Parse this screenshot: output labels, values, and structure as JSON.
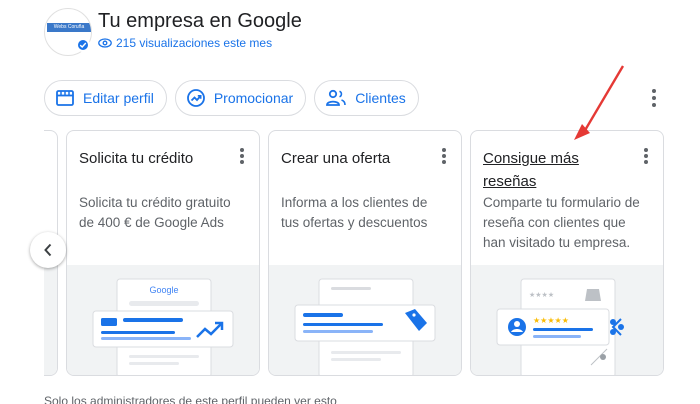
{
  "header": {
    "title": "Tu empresa en Google",
    "views_text": "215 visualizaciones este mes",
    "logo_text": "Webs Coruña"
  },
  "chips": [
    {
      "label": "Editar perfil",
      "icon": "storefront-icon"
    },
    {
      "label": "Promocionar",
      "icon": "trending-up-icon"
    },
    {
      "label": "Clientes",
      "icon": "people-icon"
    }
  ],
  "cards": [
    {
      "title": "Solicita tu crédito",
      "desc_lines": [
        "Solicita tu crédito gratuito",
        "de 400 € de Google Ads"
      ],
      "illustration": "google-ads-illustration"
    },
    {
      "title": "Crear una oferta",
      "desc_lines": [
        "Informa a los clientes de",
        "tus ofertas y descuentos"
      ],
      "illustration": "offer-tag-illustration"
    },
    {
      "title_lines": [
        "Consigue más",
        "reseñas"
      ],
      "desc_lines": [
        "Comparte tu formulario de",
        "reseña con clientes que",
        "han visitado tu empresa."
      ],
      "illustration": "reviews-illustration"
    }
  ],
  "illus_google_word": "Google",
  "footer": "Solo los administradores de este perfil pueden ver esto",
  "colors": {
    "accent": "#1a73e8",
    "annotation_arrow": "#e53935"
  }
}
